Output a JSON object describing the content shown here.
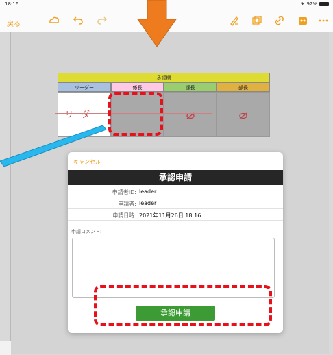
{
  "status_bar": {
    "time": "18:16",
    "battery": "92%"
  },
  "toolbar": {
    "back_label": "戻る",
    "icons": [
      "cloud-icon",
      "undo-icon",
      "redo-icon",
      "pen-icon",
      "copy-icon",
      "link-icon",
      "stamp-icon",
      "more-icon"
    ]
  },
  "approval_table": {
    "title": "承認欄",
    "columns": [
      "リーダー",
      "係長",
      "課長",
      "部長"
    ],
    "column_colors": [
      "#a9c1e0",
      "#ffc8e3",
      "#9acd6e",
      "#e0b040"
    ],
    "leader_signature": "リーダー"
  },
  "dialog": {
    "cancel_label": "キャンセル",
    "title": "承認申請",
    "rows": [
      {
        "label": "申請者ID:",
        "value": "leader"
      },
      {
        "label": "申請者:",
        "value": "leader"
      },
      {
        "label": "申請日時:",
        "value": "2021年11月26日 18:16"
      }
    ],
    "comment_label": "申請コメント:",
    "comment_value": "",
    "submit_label": "承認申請"
  },
  "colors": {
    "accent": "#f0a020",
    "highlight": "#e8101a",
    "submit": "#3d9b36"
  }
}
